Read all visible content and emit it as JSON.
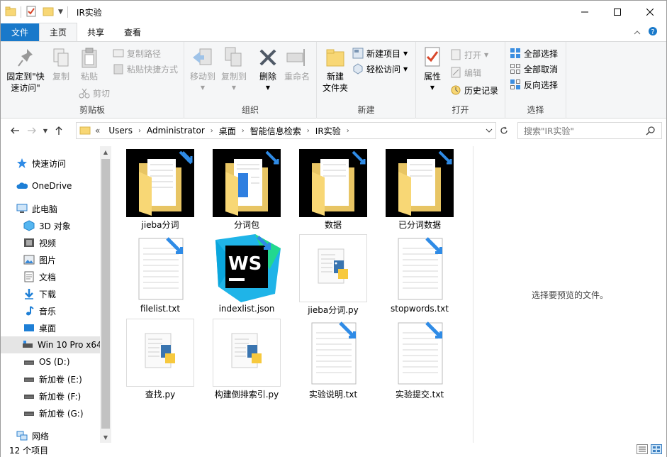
{
  "window": {
    "title": "IR实验",
    "minimize_icon": "minimize-icon",
    "maximize_icon": "maximize-icon",
    "close_icon": "close-icon"
  },
  "tabs": [
    {
      "label": "文件"
    },
    {
      "label": "主页"
    },
    {
      "label": "共享"
    },
    {
      "label": "查看"
    }
  ],
  "ribbon": {
    "clipboard": {
      "label": "剪贴板",
      "pin": "固定到\"快\n速访问\"",
      "copy": "复制",
      "paste": "粘贴",
      "copy_path": "复制路径",
      "paste_shortcut": "粘贴快捷方式",
      "cut": "剪切"
    },
    "organize": {
      "label": "组织",
      "move_to": "移动到",
      "copy_to": "复制到",
      "delete": "删除",
      "rename": "重命名"
    },
    "new": {
      "label": "新建",
      "new_folder": "新建\n文件夹",
      "new_item": "新建项目",
      "easy_access": "轻松访问"
    },
    "open": {
      "label": "打开",
      "properties": "属性",
      "open": "打开",
      "edit": "编辑",
      "history": "历史记录"
    },
    "select": {
      "label": "选择",
      "select_all": "全部选择",
      "select_none": "全部取消",
      "invert": "反向选择"
    }
  },
  "address": {
    "prefix": "«",
    "crumbs": [
      "Users",
      "Administrator",
      "桌面",
      "智能信息检索",
      "IR实验"
    ],
    "search_placeholder": "搜索\"IR实验\""
  },
  "nav": {
    "quick_access": "快速访问",
    "onedrive": "OneDrive",
    "this_pc": "此电脑",
    "objects3d": "3D 对象",
    "videos": "视频",
    "pictures": "图片",
    "documents": "文档",
    "downloads": "下载",
    "music": "音乐",
    "desktop": "桌面",
    "win10": "Win 10 Pro x64",
    "os_d": "OS (D:)",
    "vol_e": "新加卷 (E:)",
    "vol_f": "新加卷 (F:)",
    "vol_g": "新加卷 (G:)",
    "network": "网络"
  },
  "files": [
    {
      "name": "jieba分词",
      "kind": "folder"
    },
    {
      "name": "分词包",
      "kind": "folder"
    },
    {
      "name": "数据",
      "kind": "folder"
    },
    {
      "name": "已分词数据",
      "kind": "folder"
    },
    {
      "name": "filelist.txt",
      "kind": "txt"
    },
    {
      "name": "indexlist.json",
      "kind": "json"
    },
    {
      "name": "jieba分词.py",
      "kind": "py"
    },
    {
      "name": "stopwords.txt",
      "kind": "txt"
    },
    {
      "name": "查找.py",
      "kind": "py"
    },
    {
      "name": "构建倒排索引.py",
      "kind": "py"
    },
    {
      "name": "实验说明.txt",
      "kind": "txt"
    },
    {
      "name": "实验提交.txt",
      "kind": "txt"
    }
  ],
  "preview_text": "选择要预览的文件。",
  "status": {
    "count": "12 个项目"
  },
  "colors": {
    "accent": "#1979ca",
    "folder": "#f8d775",
    "shortcut_arrow": "#2f8be6"
  }
}
